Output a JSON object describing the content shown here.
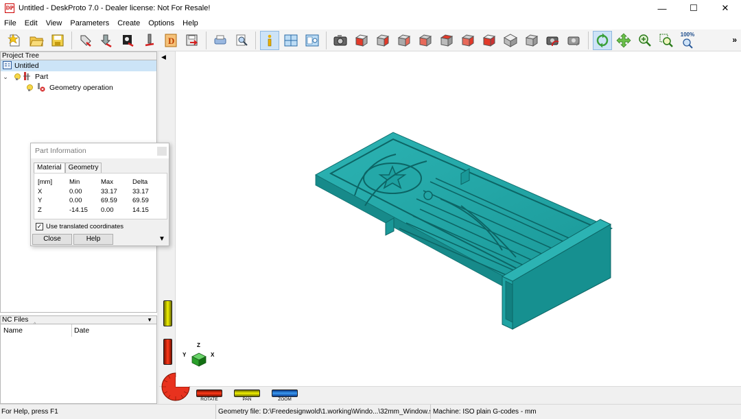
{
  "window": {
    "title": "Untitled - DeskProto 7.0 - Dealer license: Not For Resale!",
    "logo_text": "DP",
    "minimize_glyph": "—",
    "maximize_glyph": "☐",
    "close_glyph": "✕"
  },
  "menu": [
    "File",
    "Edit",
    "View",
    "Parameters",
    "Create",
    "Options",
    "Help"
  ],
  "toolbar": {
    "zoom_level": "100%",
    "more_glyph": "»",
    "icons": [
      "new-file-icon",
      "open-folder-icon",
      "save-icon",
      "import-geometry-icon",
      "import-vector-icon",
      "import-bitmap-icon",
      "import-tool-icon",
      "import-dpf-icon",
      "export-icon",
      "print-icon",
      "print-preview-icon",
      "part-info-icon",
      "layout-icon",
      "view-settings-icon",
      "camera-icon",
      "view-front-icon",
      "view-back-icon",
      "view-left-icon",
      "view-right-icon",
      "view-top-icon",
      "view-bottom-icon",
      "view-iso-icon",
      "view-iso2-icon",
      "snapshot-icon",
      "reset-view-icon",
      "rotate-mode-icon",
      "pan-mode-icon",
      "zoom-mode-icon",
      "zoom-window-icon",
      "zoom-fit-icon"
    ]
  },
  "project_tree": {
    "header": "Project Tree",
    "items": [
      {
        "label": "Untitled"
      },
      {
        "label": "Part"
      },
      {
        "label": "Geometry operation"
      }
    ]
  },
  "nc_files": {
    "header": "NC Files",
    "columns": [
      "Name",
      "Date"
    ]
  },
  "part_info": {
    "title": "Part Information",
    "tabs": [
      "Material",
      "Geometry"
    ],
    "table": {
      "header": [
        "[mm]",
        "Min",
        "Max",
        "Delta"
      ],
      "rows": [
        [
          "X",
          "0.00",
          "33.17",
          "33.17"
        ],
        [
          "Y",
          "0.00",
          "69.59",
          "69.59"
        ],
        [
          "Z",
          "-14.15",
          "0.00",
          "14.15"
        ]
      ]
    },
    "checkbox_label": "Use translated coordinates",
    "checkbox_checked": true,
    "close_label": "Close",
    "help_label": "Help"
  },
  "viewport": {
    "axes": {
      "x": "X",
      "y": "Y",
      "z": "Z"
    },
    "controls": [
      "ROTATE",
      "PAN",
      "ZOOM"
    ],
    "model_color": "#1fa6a6"
  },
  "status": {
    "help": "For Help, press F1",
    "geometry_file": "Geometry file: D:\\Freedesignwold\\1.working\\Windo...\\32mm_Window.stl",
    "machine": "Machine: ISO plain G-codes - mm"
  }
}
